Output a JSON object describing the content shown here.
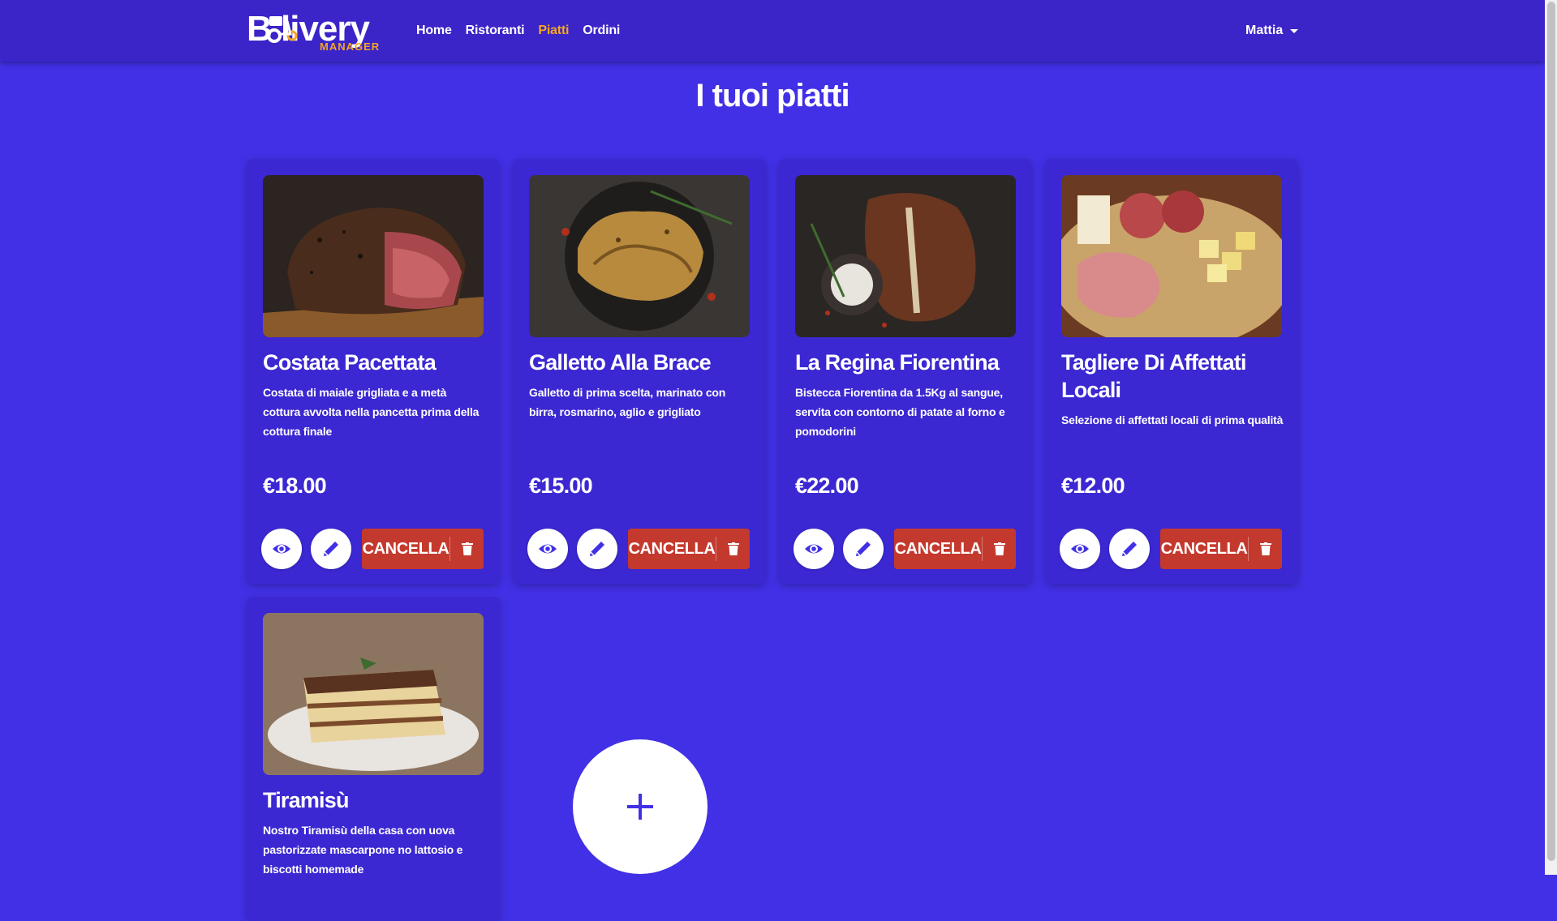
{
  "navbar": {
    "logo_main": "B  livery",
    "logo_sub": "MANAGER",
    "links": [
      {
        "label": "Home",
        "active": false
      },
      {
        "label": "Ristoranti",
        "active": false
      },
      {
        "label": "Piatti",
        "active": true
      },
      {
        "label": "Ordini",
        "active": false
      }
    ],
    "user": "Mattia"
  },
  "page": {
    "title": "I tuoi piatti"
  },
  "dishes": [
    {
      "name": "Costata Pacettata",
      "description": "Costata di maiale grigliata e a metà cottura avvolta nella pancetta prima della cottura finale",
      "price": "€18.00",
      "image": "grilled-pork-steak"
    },
    {
      "name": "Galletto Alla Brace",
      "description": "Galletto di prima scelta, marinato con birra, rosmarino, aglio e grigliato",
      "price": "€15.00",
      "image": "grilled-chicken"
    },
    {
      "name": "La Regina Fiorentina",
      "description": "Bistecca Fiorentina da 1.5Kg al sangue, servita con contorno di patate al forno e pomodorini",
      "price": "€22.00",
      "image": "t-bone-steak"
    },
    {
      "name": "Tagliere Di Affettati Locali",
      "description": "Selezione di affettati locali di prima qualità",
      "price": "€12.00",
      "image": "cured-meats-board"
    },
    {
      "name": "Tiramisù",
      "description": "Nostro Tiramisù della casa con uova pastorizzate mascarpone no lattosio e biscotti homemade",
      "price": "",
      "image": "tiramisu"
    }
  ],
  "actions": {
    "delete_label": "CANCELLA",
    "add_symbol": "+"
  },
  "colors": {
    "background": "#4230e6",
    "navbar": "#3b24c8",
    "card": "#3b28d2",
    "accent": "#f5a623",
    "danger": "#c4392d"
  }
}
